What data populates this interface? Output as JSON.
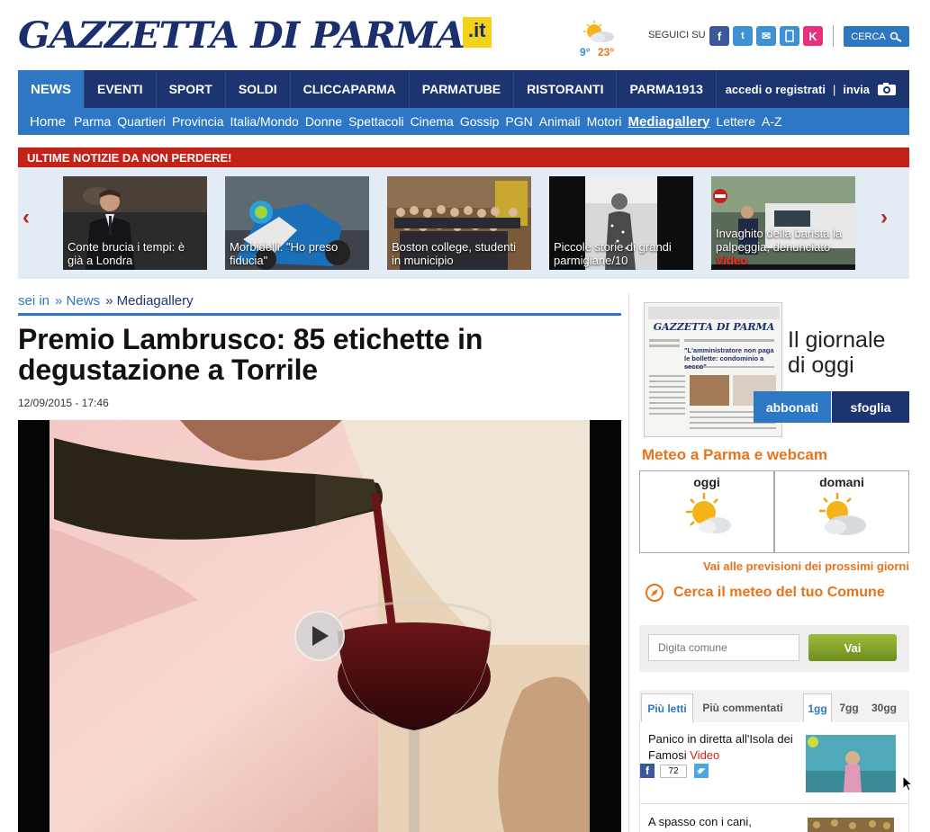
{
  "masthead": {
    "brand": "GAZZETTA DI PARMA",
    "tld": ".it",
    "weather": {
      "min": "9°",
      "max": "23°",
      "icon": "partly-sunny-icon"
    },
    "follow_label": "SEGUICI SU",
    "social": [
      {
        "name": "facebook",
        "glyph": "f",
        "color": "#3b5998"
      },
      {
        "name": "twitter",
        "glyph": "t",
        "color": "#3f91d6"
      },
      {
        "name": "email",
        "glyph": "✉",
        "color": "#3f91d6"
      },
      {
        "name": "mobile",
        "glyph": "▯",
        "color": "#3f91d6"
      },
      {
        "name": "kiosk",
        "glyph": "K",
        "color": "#e8317d"
      }
    ],
    "search_label": "CERCA"
  },
  "nav": {
    "main": [
      "NEWS",
      "EVENTI",
      "SPORT",
      "SOLDI",
      "CLICCAPARMA",
      "PARMATUBE",
      "RISTORANTI",
      "PARMA1913"
    ],
    "account": "accedi o registrati",
    "send": "invia",
    "sub": [
      "Home",
      "Parma",
      "Quartieri",
      "Provincia",
      "Italia/Mondo",
      "Donne",
      "Spettacoli",
      "Cinema",
      "Gossip",
      "PGN",
      "Animali",
      "Motori",
      "Mediagallery",
      "Lettere",
      "A-Z"
    ]
  },
  "must_read": {
    "heading": "ULTIME NOTIZIE DA NON PERDERE!",
    "cards": [
      {
        "caption": "Conte brucia i tempi: è già a Londra",
        "video": ""
      },
      {
        "caption": "Morbidelli: \"Ho preso fiducia\"",
        "video": ""
      },
      {
        "caption": "Boston college, studenti in municipio",
        "video": ""
      },
      {
        "caption": "Piccole storie di grandi parmigiane/10",
        "video": ""
      },
      {
        "caption": "Invaghito della barista la palpeggia, denunciato",
        "video": "Video"
      }
    ]
  },
  "article": {
    "crumb_prefix": "sei in",
    "crumbs": [
      "» News",
      "» Mediagallery"
    ],
    "title": "Premio Lambrusco: 85 etichette in degustazione a Torrile",
    "date": "12/09/2015 - 17:46"
  },
  "sidebar": {
    "paper_line1": "Il giornale",
    "paper_line2": "di oggi",
    "paper_masthead": "GAZZETTA DI PARMA",
    "paper_headline": "\"L'amministratore non paga le bollette: condominio a secco\"",
    "subscribe": "abbonati",
    "browse": "sfoglia",
    "meteo_heading": "Meteo a Parma e webcam",
    "today": "oggi",
    "tomorrow": "domani",
    "forecast_link": "Vai alle previsioni dei prossimi giorni",
    "search_meteo": "Cerca il meteo del tuo Comune",
    "comune_placeholder": "Digita comune",
    "go": "Vai",
    "tabs": [
      "Più letti",
      "Più commentati",
      "1gg",
      "7gg",
      "30gg"
    ],
    "list": [
      {
        "text": "Panico in diretta all'Isola dei Famosi",
        "video": "Video",
        "shares": "72"
      },
      {
        "text": "A spasso con i cani,",
        "video": ""
      }
    ]
  }
}
